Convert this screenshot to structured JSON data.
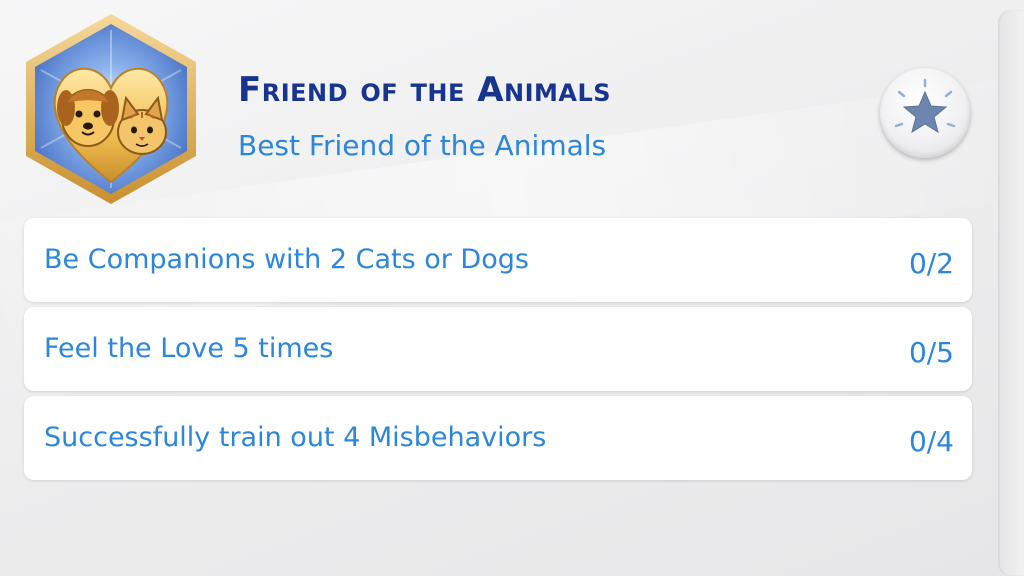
{
  "aspiration": {
    "title": "Friend of the Animals",
    "subtitle": "Best Friend of the Animals",
    "icon": "pets-heart-icon",
    "action_icon": "star-icon"
  },
  "goals": [
    {
      "label": "Be Companions with 2 Cats or Dogs",
      "progress": "0/2"
    },
    {
      "label": "Feel the Love 5 times",
      "progress": "0/5"
    },
    {
      "label": "Successfully train out 4 Misbehaviors",
      "progress": "0/4"
    }
  ],
  "colors": {
    "title": "#17358e",
    "accent": "#2b86dc",
    "badge_frame": "#e6b452",
    "badge_fill": "#7da7e8"
  }
}
